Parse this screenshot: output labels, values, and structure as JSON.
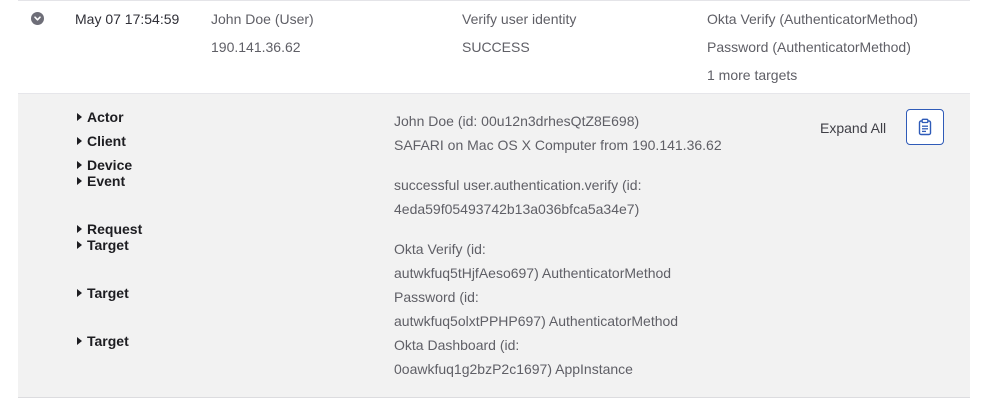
{
  "event": {
    "time": "May 07 17:54:59",
    "actor": "John Doe (User)",
    "ip": "190.141.36.62",
    "action": "Verify user identity",
    "outcome": "SUCCESS",
    "targets": [
      "Okta Verify  (AuthenticatorMethod)",
      "Password  (AuthenticatorMethod)"
    ],
    "more_targets": "1 more targets"
  },
  "details": {
    "sections": [
      "Actor",
      "Client",
      "Device",
      "Event",
      "Request",
      "Target",
      "Target",
      "Target"
    ],
    "values": {
      "actor": "John Doe (id: 00u12n3drhesQtZ8E698)",
      "client": "SAFARI on Mac OS X Computer  from 190.141.36.62",
      "event_line1": "successful user.authentication.verify  (id:",
      "event_line2": "4eda59f05493742b13a036bfca5a34e7)",
      "target1_line1": "Okta Verify (id:",
      "target1_line2": "autwkfuq5tHjfAeso697) AuthenticatorMethod",
      "target2_line1": "Password (id:",
      "target2_line2": "autwkfuq5olxtPPHP697) AuthenticatorMethod",
      "target3_line1": "Okta Dashboard (id:",
      "target3_line2": "0oawkfuq1g2bzP2c1697) AppInstance"
    },
    "expand_all": "Expand All"
  },
  "icons": {
    "row_toggle": "chevron-down-circle-icon",
    "copy": "clipboard-icon"
  },
  "colors": {
    "accent": "#2f5bb8",
    "panel_bg": "#f2f2f2"
  }
}
